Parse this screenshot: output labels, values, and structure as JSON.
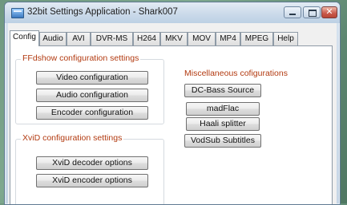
{
  "window": {
    "title": "32bit Settings Application - Shark007",
    "close_glyph": "✕"
  },
  "tabs": [
    "Config",
    "Audio",
    "AVI",
    "DVR-MS",
    "H264",
    "MKV",
    "MOV",
    "MP4",
    "MPEG",
    "Help"
  ],
  "ffdshow": {
    "title": "FFdshow configuration settings",
    "buttons": [
      "Video configuration",
      "Audio configuration",
      "Encoder configuration"
    ]
  },
  "xvid": {
    "title": "XviD configuration settings",
    "buttons": [
      "XviD decoder options",
      "XviD encoder options"
    ]
  },
  "misc": {
    "title": "Miscellaneous cofigurations",
    "buttons": [
      "DC-Bass Source",
      "madFlac",
      "Haali splitter",
      "VodSub Subtitles"
    ]
  }
}
